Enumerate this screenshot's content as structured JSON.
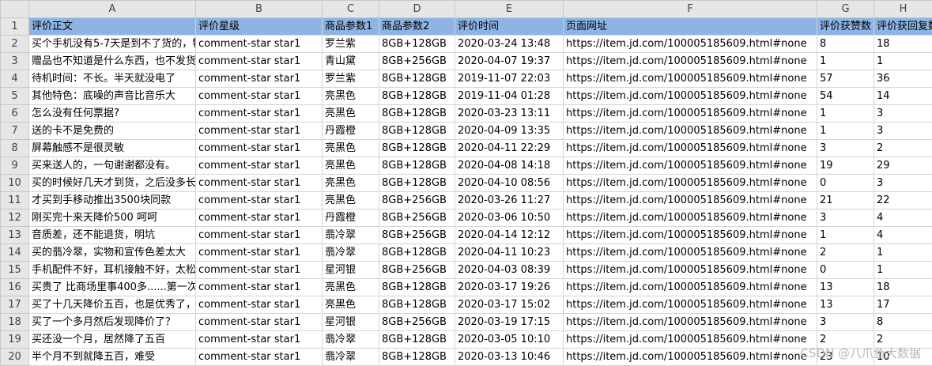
{
  "column_letters": [
    "A",
    "B",
    "C",
    "D",
    "E",
    "F",
    "G",
    "H"
  ],
  "header_row": [
    "评价正文",
    "评价星级",
    "商品参数1",
    "商品参数2",
    "评价时间",
    "页面网址",
    "评价获赞数",
    "评价获回复数"
  ],
  "rows": [
    [
      "买个手机没有5-7天是到不了货的，特",
      "comment-star star1",
      "罗兰紫",
      "8GB+128GB",
      "2020-03-24 13:48",
      "https://item.jd.com/100005185609.html#none",
      "8",
      "18"
    ],
    [
      "赠品也不知道是什么东西，也不发货",
      "comment-star star1",
      "青山黛",
      "8GB+256GB",
      "2020-04-07 19:37",
      "https://item.jd.com/100005185609.html#none",
      "1",
      "1"
    ],
    [
      "待机时间：不长。半天就没电了",
      "comment-star star1",
      "罗兰紫",
      "8GB+128GB",
      "2019-11-07 22:03",
      "https://item.jd.com/100005185609.html#none",
      "57",
      "36"
    ],
    [
      "其他特色：底噪的声音比音乐大",
      "comment-star star1",
      "亮黑色",
      "8GB+128GB",
      "2019-11-04 01:28",
      "https://item.jd.com/100005185609.html#none",
      "54",
      "14"
    ],
    [
      "怎么没有任何票据?",
      "comment-star star1",
      "亮黑色",
      "8GB+128GB",
      "2020-03-23 13:11",
      "https://item.jd.com/100005185609.html#none",
      "1",
      "3"
    ],
    [
      "送的卡不是免费的",
      "comment-star star1",
      "丹霞橙",
      "8GB+128GB",
      "2020-04-09 13:35",
      "https://item.jd.com/100005185609.html#none",
      "1",
      "3"
    ],
    [
      "屏幕触感不是很灵敏",
      "comment-star star1",
      "亮黑色",
      "8GB+128GB",
      "2020-04-11 22:29",
      "https://item.jd.com/100005185609.html#none",
      "3",
      "2"
    ],
    [
      "买来送人的，一句谢谢都没有。",
      "comment-star star1",
      "亮黑色",
      "8GB+128GB",
      "2020-04-08 14:18",
      "https://item.jd.com/100005185609.html#none",
      "19",
      "29"
    ],
    [
      "买的时候好几天才到货，之后没多长",
      "comment-star star1",
      "亮黑色",
      "8GB+128GB",
      "2020-04-10 08:56",
      "https://item.jd.com/100005185609.html#none",
      "0",
      "3"
    ],
    [
      "才买到手移动推出3500块同款",
      "comment-star star1",
      "亮黑色",
      "8GB+256GB",
      "2020-03-26 11:27",
      "https://item.jd.com/100005185609.html#none",
      "21",
      "22"
    ],
    [
      "刚买完十来天降价500 呵呵",
      "comment-star star1",
      "丹霞橙",
      "8GB+256GB",
      "2020-03-06 10:50",
      "https://item.jd.com/100005185609.html#none",
      "3",
      "4"
    ],
    [
      "音质差，还不能退货，明坑",
      "comment-star star1",
      "翡冷翠",
      "8GB+256GB",
      "2020-04-14 12:12",
      "https://item.jd.com/100005185609.html#none",
      "1",
      "4"
    ],
    [
      "买的翡冷翠，实物和宣传色差太大",
      "comment-star star1",
      "翡冷翠",
      "8GB+128GB",
      "2020-04-11 10:23",
      "https://item.jd.com/100005185609.html#none",
      "2",
      "1"
    ],
    [
      "手机配件不好，耳机接触不好，太松",
      "comment-star star1",
      "星河银",
      "8GB+256GB",
      "2020-04-03 08:39",
      "https://item.jd.com/100005185609.html#none",
      "0",
      "1"
    ],
    [
      "买贵了 比商场里事400多......第一次",
      "comment-star star1",
      "亮黑色",
      "8GB+128GB",
      "2020-03-17 19:26",
      "https://item.jd.com/100005185609.html#none",
      "13",
      "18"
    ],
    [
      "买了十几天降价五百，也是优秀了，",
      "comment-star star1",
      "亮黑色",
      "8GB+128GB",
      "2020-03-17 15:02",
      "https://item.jd.com/100005185609.html#none",
      "13",
      "17"
    ],
    [
      "买了一个多月然后发现降价了？",
      "comment-star star1",
      "星河银",
      "8GB+256GB",
      "2020-03-19 17:15",
      "https://item.jd.com/100005185609.html#none",
      "3",
      "8"
    ],
    [
      "买还没一个月，居然降了五百",
      "comment-star star1",
      "翡冷翠",
      "8GB+128GB",
      "2020-03-05 10:10",
      "https://item.jd.com/100005185609.html#none",
      "2",
      "2"
    ],
    [
      "半个月不到就降五百，难受",
      "comment-star star1",
      "翡冷翠",
      "8GB+128GB",
      "2020-03-13 10:46",
      "https://item.jd.com/100005185609.html#none",
      "23",
      "10"
    ]
  ],
  "watermark": "CSDN @八爪鱼大数据"
}
